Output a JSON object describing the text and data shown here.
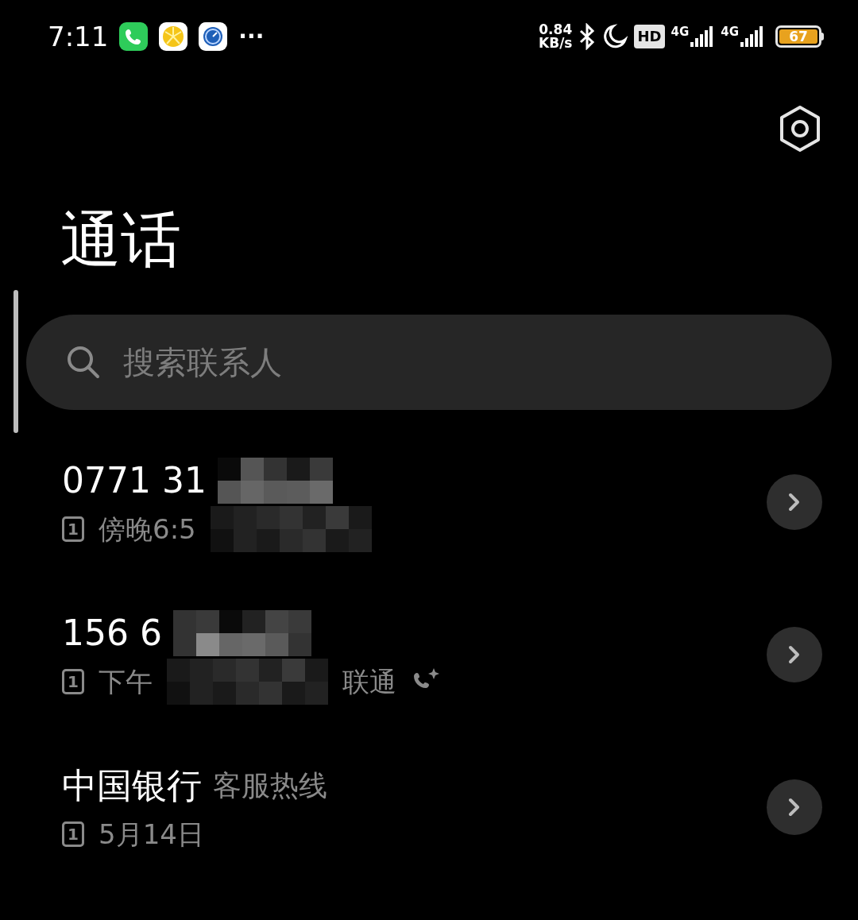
{
  "status_bar": {
    "time": "7:11",
    "more": "···",
    "net_speed": "0.84",
    "net_unit": "KB/s",
    "hd_badge": "HD",
    "sim1_network": "4G",
    "sim2_network": "4G",
    "battery": "67"
  },
  "title": "通话",
  "search": {
    "placeholder": "搜索联系人"
  },
  "calls": [
    {
      "kind": "masked",
      "name": "0771 31",
      "sim": "1",
      "time": "傍晚6:5",
      "smart_call": false
    },
    {
      "kind": "masked",
      "name": "156 6",
      "sim": "1",
      "time": "下午",
      "location": "联通",
      "smart_call": true
    },
    {
      "kind": "plain",
      "name": "中国银行",
      "tag": "客服热线",
      "sim": "1",
      "time": "5月14日",
      "smart_call": false
    }
  ]
}
